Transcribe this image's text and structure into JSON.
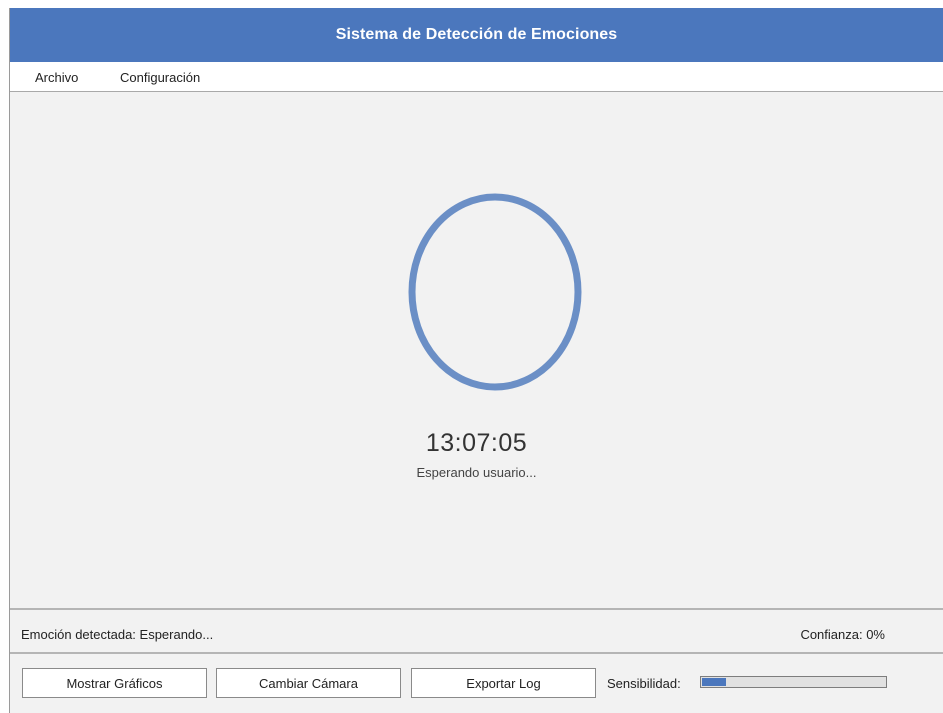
{
  "window": {
    "title": "Sistema de Detección de Emociones"
  },
  "menu": {
    "items": [
      "Archivo",
      "Configuración"
    ]
  },
  "main": {
    "face_icon": "face-outline-oval",
    "clock": "13:07:05",
    "status": "Esperando usuario..."
  },
  "status_bar": {
    "emotion": "Emoción detectada: Esperando...",
    "confidence": "Confianza: 0%"
  },
  "bottom_bar": {
    "buttons": [
      "Mostrar Gráficos",
      "Cambiar Cámara",
      "Exportar Log"
    ],
    "sensitivity_label": "Sensibilidad:",
    "sensitivity_value": 0.13
  },
  "colors": {
    "accent": "#4b77bd",
    "face_outline": "#6b8fc6",
    "background": "#f2f2f2"
  }
}
